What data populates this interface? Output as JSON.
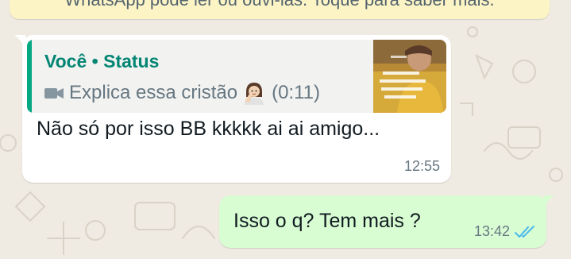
{
  "encryption_notice": "WhatsApp pode ler ou ouvi-las. Toque para saber mais.",
  "incoming": {
    "quote": {
      "author": "Você • Status",
      "media_icon": "video-camera-icon",
      "caption": "Explica essa cristão",
      "emoji": "woman-tipping-hand-emoji",
      "duration": "(0:11)"
    },
    "text": "Não só por isso BB kkkkk ai ai amigo...",
    "time": "12:55"
  },
  "outgoing": {
    "text": "Isso o q? Tem mais ?",
    "time": "13:42",
    "status_icon": "double-check-read-icon"
  },
  "colors": {
    "wallpaper": "#efeae2",
    "incoming_bubble": "#ffffff",
    "outgoing_bubble": "#d9fdd3",
    "quote_accent": "#06a884",
    "read_ticks": "#53bdeb"
  }
}
